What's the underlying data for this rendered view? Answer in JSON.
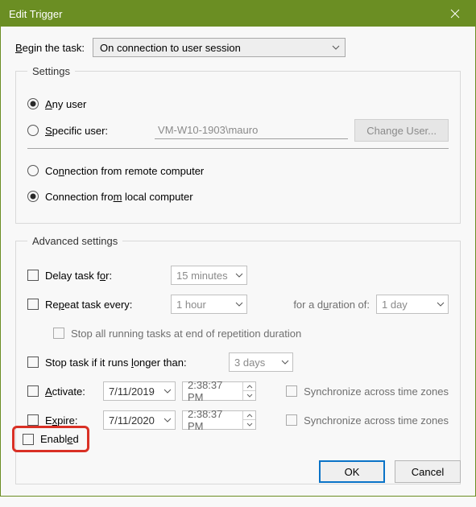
{
  "window": {
    "title": "Edit Trigger"
  },
  "begin": {
    "label": "Begin the task:",
    "selected": "On connection to user session"
  },
  "settings": {
    "legend": "Settings",
    "any_user": {
      "label": "Any user",
      "selected": true
    },
    "specific_user": {
      "label": "Specific user:",
      "selected": false,
      "value": "VM-W10-1903\\mauro"
    },
    "change_user_btn": "Change User...",
    "conn_remote": {
      "label": "Connection from remote computer",
      "selected": false
    },
    "conn_local": {
      "label": "Connection from local computer",
      "selected": true
    }
  },
  "advanced": {
    "legend": "Advanced settings",
    "delay_task": {
      "label": "Delay task for:",
      "value": "15 minutes",
      "checked": false
    },
    "repeat": {
      "label": "Repeat task every:",
      "value": "1 hour",
      "checked": false
    },
    "duration": {
      "label": "for a duration of:",
      "value": "1 day"
    },
    "stop_at_end": {
      "label": "Stop all running tasks at end of repetition duration",
      "checked": false
    },
    "stop_if_longer": {
      "label": "Stop task if it runs longer than:",
      "value": "3 days",
      "checked": false
    },
    "activate": {
      "label": "Activate:",
      "date": "7/11/2019",
      "time": "2:38:37 PM",
      "checked": false
    },
    "expire": {
      "label": "Expire:",
      "date": "7/11/2020",
      "time": "2:38:37 PM",
      "checked": false
    },
    "sync_tz": "Synchronize across time zones",
    "enabled": {
      "label": "Enabled",
      "checked": false
    }
  },
  "footer": {
    "ok": "OK",
    "cancel": "Cancel"
  }
}
